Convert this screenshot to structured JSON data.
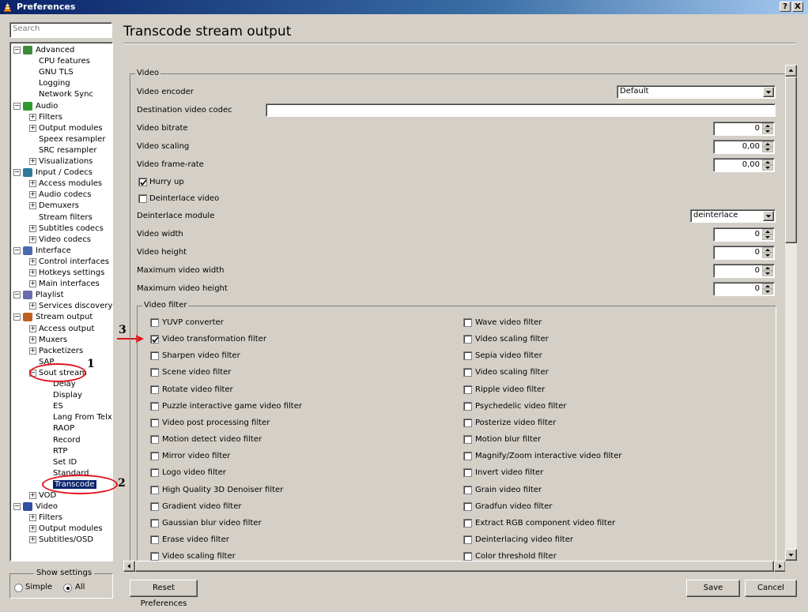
{
  "window": {
    "title": "Preferences",
    "help_label": "?",
    "close_label": "X"
  },
  "search": {
    "placeholder": "Search"
  },
  "tree": {
    "items": [
      {
        "label": "Advanced"
      },
      {
        "label": "CPU features"
      },
      {
        "label": "GNU TLS"
      },
      {
        "label": "Logging"
      },
      {
        "label": "Network Sync"
      },
      {
        "label": "Audio"
      },
      {
        "label": "Filters"
      },
      {
        "label": "Output modules"
      },
      {
        "label": "Speex resampler"
      },
      {
        "label": "SRC resampler"
      },
      {
        "label": "Visualizations"
      },
      {
        "label": "Input / Codecs"
      },
      {
        "label": "Access modules"
      },
      {
        "label": "Audio codecs"
      },
      {
        "label": "Demuxers"
      },
      {
        "label": "Stream filters"
      },
      {
        "label": "Subtitles codecs"
      },
      {
        "label": "Video codecs"
      },
      {
        "label": "Interface"
      },
      {
        "label": "Control interfaces"
      },
      {
        "label": "Hotkeys settings"
      },
      {
        "label": "Main interfaces"
      },
      {
        "label": "Playlist"
      },
      {
        "label": "Services discovery"
      },
      {
        "label": "Stream output"
      },
      {
        "label": "Access output"
      },
      {
        "label": "Muxers"
      },
      {
        "label": "Packetizers"
      },
      {
        "label": "SAP"
      },
      {
        "label": "Sout stream"
      },
      {
        "label": "Delay"
      },
      {
        "label": "Display"
      },
      {
        "label": "ES"
      },
      {
        "label": "Lang From Telx"
      },
      {
        "label": "RAOP"
      },
      {
        "label": "Record"
      },
      {
        "label": "RTP"
      },
      {
        "label": "Set ID"
      },
      {
        "label": "Standard"
      },
      {
        "label": "Transcode"
      },
      {
        "label": "VOD"
      },
      {
        "label": "Video"
      },
      {
        "label": "Filters"
      },
      {
        "label": "Output modules"
      },
      {
        "label": "Subtitles/OSD"
      }
    ],
    "selected": "Transcode"
  },
  "annotations": {
    "mark1": "1",
    "mark2": "2",
    "mark3": "3",
    "accent": "#e0141e"
  },
  "show_settings": {
    "legend": "Show settings",
    "simple": "Simple",
    "all": "All",
    "selected": "All"
  },
  "page": {
    "title": "Transcode stream output"
  },
  "video": {
    "group_label": "Video",
    "encoder": {
      "label": "Video encoder",
      "value": "Default"
    },
    "dest_codec": {
      "label": "Destination video codec",
      "value": ""
    },
    "bitrate": {
      "label": "Video bitrate",
      "value": "0"
    },
    "scaling": {
      "label": "Video scaling",
      "value": "0,00"
    },
    "framerate": {
      "label": "Video frame-rate",
      "value": "0,00"
    },
    "hurry_up": {
      "label": "Hurry up",
      "checked": true
    },
    "deinterlace": {
      "label": "Deinterlace video",
      "checked": false
    },
    "deint_module": {
      "label": "Deinterlace module",
      "value": "deinterlace"
    },
    "width": {
      "label": "Video width",
      "value": "0"
    },
    "height": {
      "label": "Video height",
      "value": "0"
    },
    "max_width": {
      "label": "Maximum video width",
      "value": "0"
    },
    "max_height": {
      "label": "Maximum video height",
      "value": "0"
    }
  },
  "video_filter": {
    "group_label": "Video filter",
    "left": [
      {
        "label": "YUVP converter",
        "checked": false
      },
      {
        "label": "Video transformation filter",
        "checked": true
      },
      {
        "label": "Sharpen video filter",
        "checked": false
      },
      {
        "label": "Scene video filter",
        "checked": false
      },
      {
        "label": "Rotate video filter",
        "checked": false
      },
      {
        "label": "Puzzle interactive game video filter",
        "checked": false
      },
      {
        "label": "Video post processing filter",
        "checked": false
      },
      {
        "label": "Motion detect video filter",
        "checked": false
      },
      {
        "label": "Mirror video filter",
        "checked": false
      },
      {
        "label": "Logo video filter",
        "checked": false
      },
      {
        "label": "High Quality 3D Denoiser filter",
        "checked": false
      },
      {
        "label": "Gradient video filter",
        "checked": false
      },
      {
        "label": "Gaussian blur video filter",
        "checked": false
      },
      {
        "label": "Erase video filter",
        "checked": false
      },
      {
        "label": "Video scaling filter",
        "checked": false
      }
    ],
    "right": [
      {
        "label": "Wave video filter",
        "checked": false
      },
      {
        "label": "Video scaling filter",
        "checked": false
      },
      {
        "label": "Sepia video filter",
        "checked": false
      },
      {
        "label": "Video scaling filter",
        "checked": false
      },
      {
        "label": "Ripple video filter",
        "checked": false
      },
      {
        "label": "Psychedelic video filter",
        "checked": false
      },
      {
        "label": "Posterize video filter",
        "checked": false
      },
      {
        "label": "Motion blur filter",
        "checked": false
      },
      {
        "label": "Magnify/Zoom interactive video filter",
        "checked": false
      },
      {
        "label": "Invert video filter",
        "checked": false
      },
      {
        "label": "Grain video filter",
        "checked": false
      },
      {
        "label": "Gradfun video filter",
        "checked": false
      },
      {
        "label": "Extract RGB component video filter",
        "checked": false
      },
      {
        "label": "Deinterlacing video filter",
        "checked": false
      },
      {
        "label": "Color threshold filter",
        "checked": false
      }
    ]
  },
  "buttons": {
    "reset": "Reset Preferences",
    "save": "Save",
    "cancel": "Cancel"
  }
}
